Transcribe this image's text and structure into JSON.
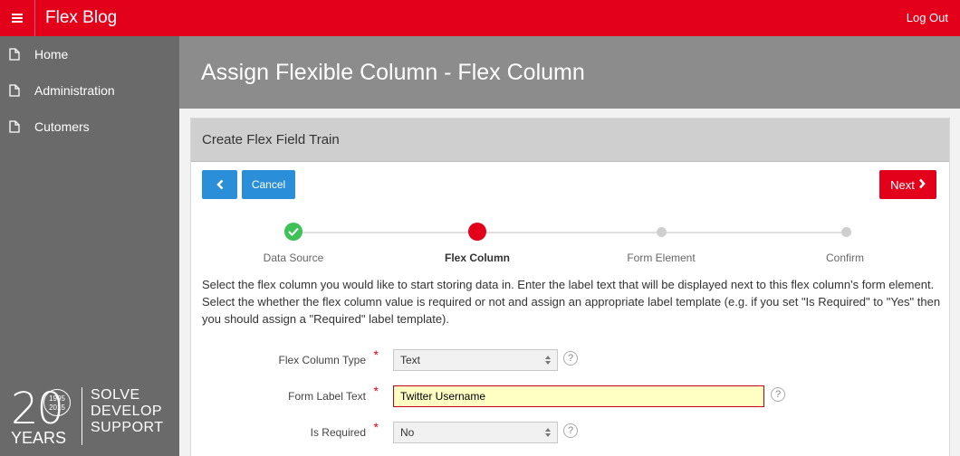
{
  "header": {
    "app_title": "Flex Blog",
    "logout_label": "Log Out"
  },
  "sidebar": {
    "items": [
      {
        "label": "Home",
        "icon": "page-icon"
      },
      {
        "label": "Administration",
        "icon": "page-icon"
      },
      {
        "label": "Cutomers",
        "icon": "page-icon"
      }
    ],
    "logo": {
      "number": "20",
      "years_top": "1995",
      "years_bottom": "2015",
      "years": "YEARS",
      "tagline": [
        "SOLVE",
        "DEVELOP",
        "SUPPORT"
      ]
    }
  },
  "main": {
    "page_title": "Assign Flexible Column - Flex Column",
    "region_title": "Create Flex Field Train",
    "buttons": {
      "previous_icon": "chevron-left-icon",
      "cancel_label": "Cancel",
      "next_label": "Next"
    },
    "train": {
      "steps": [
        {
          "label": "Data Source",
          "state": "complete"
        },
        {
          "label": "Flex Column",
          "state": "current"
        },
        {
          "label": "Form Element",
          "state": "pending"
        },
        {
          "label": "Confirm",
          "state": "pending"
        }
      ]
    },
    "description": "Select the flex column you would like to start storing data in. Enter the label text that will be displayed next to this flex column's form element. Select the whether the flex column value is required or not and assign an appropriate label template (e.g. if you set \"Is Required\" to \"Yes\" then you should assign a \"Required\" label template).",
    "form": {
      "flex_column_type": {
        "label": "Flex Column Type",
        "value": "Text",
        "required_mark": "*"
      },
      "form_label_text": {
        "label": "Form Label Text",
        "value": "Twitter Username",
        "required_mark": "*"
      },
      "is_required": {
        "label": "Is Required",
        "value": "No",
        "required_mark": "*"
      },
      "help_symbol": "?"
    }
  },
  "colors": {
    "brand_red": "#e3001b",
    "sidebar_gray": "#6a6a6a",
    "hero_gray": "#8c8c8c",
    "button_blue": "#2a8fd8",
    "success_green": "#3ec156"
  }
}
